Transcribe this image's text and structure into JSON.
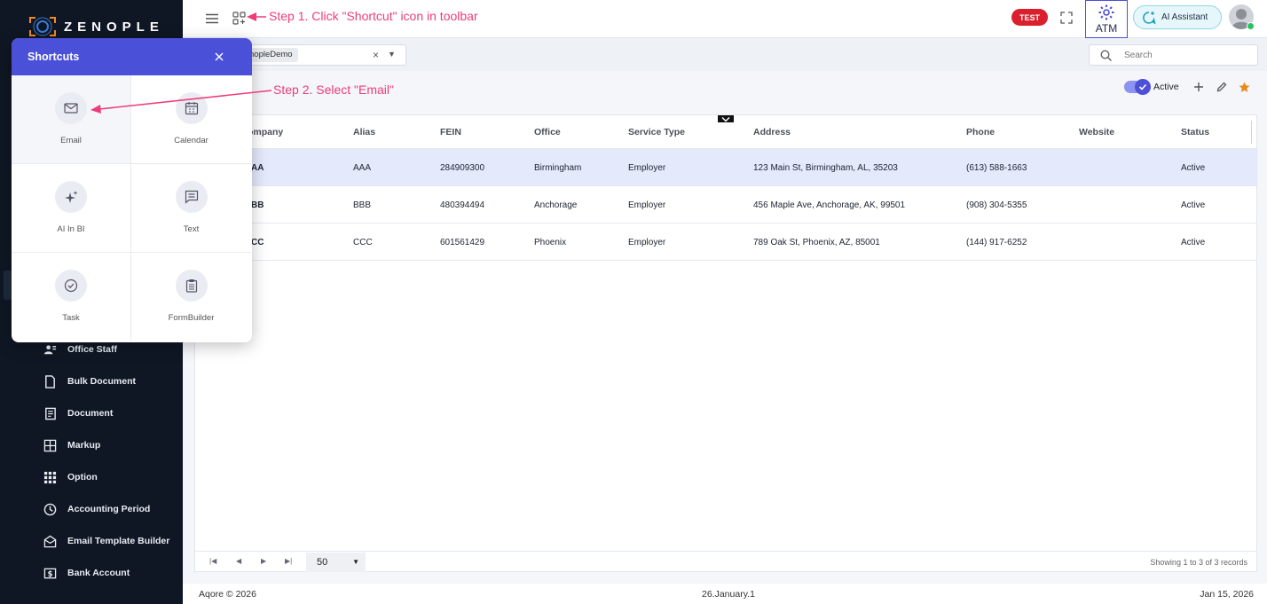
{
  "brand": {
    "name": "ZENOPLE"
  },
  "annotations": {
    "step1": "Step 1. Click \"Shortcut\" icon in toolbar",
    "step2": "Step 2. Select \"Email\""
  },
  "topbar": {
    "env_badge": "TEST",
    "atm_label": "ATM",
    "ai_label": "AI Assistant"
  },
  "filter": {
    "chip": "nopleDemo",
    "clear": "×",
    "search_placeholder": "Search"
  },
  "toolbar": {
    "active_label": "Active"
  },
  "shortcuts": {
    "title": "Shortcuts",
    "items": [
      {
        "label": "Email",
        "icon": "mail-icon"
      },
      {
        "label": "Calendar",
        "icon": "calendar-icon"
      },
      {
        "label": "AI In BI",
        "icon": "sparkle-icon"
      },
      {
        "label": "Text",
        "icon": "message-icon"
      },
      {
        "label": "Task",
        "icon": "check-circle-icon"
      },
      {
        "label": "FormBuilder",
        "icon": "clipboard-icon"
      }
    ]
  },
  "sidebar": {
    "items": [
      {
        "label": "Office Staff",
        "icon": "people-icon"
      },
      {
        "label": "Bulk Document",
        "icon": "file-icon"
      },
      {
        "label": "Document",
        "icon": "document-icon"
      },
      {
        "label": "Markup",
        "icon": "grid-icon"
      },
      {
        "label": "Option",
        "icon": "dots-grid-icon"
      },
      {
        "label": "Accounting Period",
        "icon": "clock-icon"
      },
      {
        "label": "Email Template Builder",
        "icon": "envelope-open-icon"
      },
      {
        "label": "Bank Account",
        "icon": "dollar-icon"
      }
    ]
  },
  "table": {
    "columns": [
      "ompany",
      "Alias",
      "FEIN",
      "Office",
      "Service Type",
      "Address",
      "Phone",
      "Website",
      "Status"
    ],
    "rows": [
      [
        "AA",
        "AAA",
        "284909300",
        "Birmingham",
        "Employer",
        "123 Main St, Birmingham, AL, 35203",
        "(613) 588-1663",
        "",
        "Active"
      ],
      [
        "BB",
        "BBB",
        "480394494",
        "Anchorage",
        "Employer",
        "456 Maple Ave, Anchorage, AK, 99501",
        "(908) 304-5355",
        "",
        "Active"
      ],
      [
        "CC",
        "CCC",
        "601561429",
        "Phoenix",
        "Employer",
        "789 Oak St, Phoenix, AZ, 85001",
        "(144) 917-6252",
        "",
        "Active"
      ]
    ]
  },
  "pager": {
    "page_size": "50",
    "records": "Showing 1 to 3 of 3 records"
  },
  "footer": {
    "copyright": "Aqore © 2026",
    "version": "26.January.1",
    "date": "Jan 15, 2026"
  },
  "colors": {
    "sidebar_bg": "#0f1724",
    "accent": "#4b50d8",
    "annotation": "#ee3c7b",
    "badge_red": "#d9202c",
    "row_selected": "#e4e9fb"
  }
}
